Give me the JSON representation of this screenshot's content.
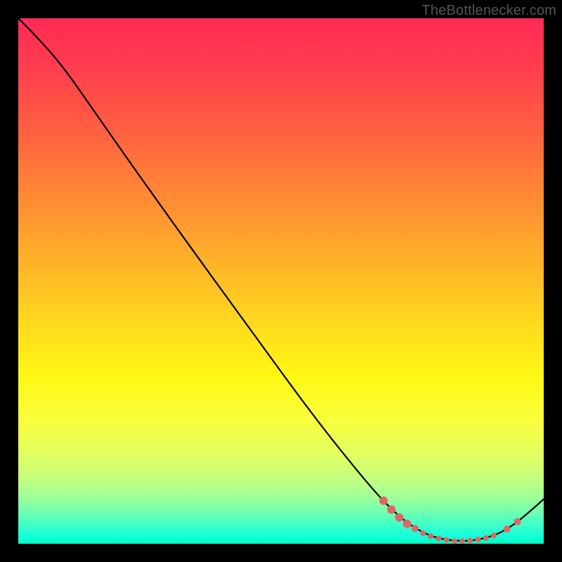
{
  "attribution": "TheBottlenecker.com",
  "chart_data": {
    "type": "line",
    "title": "",
    "xlabel": "",
    "ylabel": "",
    "xlim": [
      0,
      100
    ],
    "ylim": [
      0,
      100
    ],
    "curve": {
      "name": "bottleneck-curve",
      "color": "#000000",
      "points": [
        {
          "x": 0,
          "y": 100
        },
        {
          "x": 3,
          "y": 97
        },
        {
          "x": 8,
          "y": 91.5
        },
        {
          "x": 14,
          "y": 83
        },
        {
          "x": 22,
          "y": 71.5
        },
        {
          "x": 32,
          "y": 57.5
        },
        {
          "x": 44,
          "y": 41
        },
        {
          "x": 56,
          "y": 24.5
        },
        {
          "x": 66,
          "y": 12
        },
        {
          "x": 71,
          "y": 6.5
        },
        {
          "x": 75,
          "y": 3.2
        },
        {
          "x": 79,
          "y": 1.2
        },
        {
          "x": 83,
          "y": 0.5
        },
        {
          "x": 87,
          "y": 0.6
        },
        {
          "x": 91,
          "y": 1.7
        },
        {
          "x": 94,
          "y": 3.4
        },
        {
          "x": 97,
          "y": 5.8
        },
        {
          "x": 100,
          "y": 8.5
        }
      ]
    },
    "markers": {
      "name": "highlighted-region",
      "color": "#e06666",
      "radius_style": "varied",
      "points": [
        {
          "x": 69.5,
          "y": 8.2,
          "r": 6
        },
        {
          "x": 71.0,
          "y": 6.5,
          "r": 6
        },
        {
          "x": 72.5,
          "y": 5.0,
          "r": 6
        },
        {
          "x": 74.0,
          "y": 3.8,
          "r": 6
        },
        {
          "x": 75.5,
          "y": 2.9,
          "r": 5
        },
        {
          "x": 77.0,
          "y": 2.0,
          "r": 4
        },
        {
          "x": 78.5,
          "y": 1.4,
          "r": 4
        },
        {
          "x": 80.0,
          "y": 1.0,
          "r": 4
        },
        {
          "x": 81.5,
          "y": 0.7,
          "r": 4
        },
        {
          "x": 83.0,
          "y": 0.5,
          "r": 4
        },
        {
          "x": 84.5,
          "y": 0.5,
          "r": 4
        },
        {
          "x": 86.0,
          "y": 0.6,
          "r": 4
        },
        {
          "x": 87.5,
          "y": 0.8,
          "r": 4
        },
        {
          "x": 89.0,
          "y": 1.1,
          "r": 4
        },
        {
          "x": 90.5,
          "y": 1.6,
          "r": 4
        },
        {
          "x": 93.0,
          "y": 2.8,
          "r": 5
        },
        {
          "x": 95.0,
          "y": 4.2,
          "r": 5
        }
      ]
    },
    "gradient_stops_comment": "background vertical gradient from red (top, high bottleneck) to green (bottom, low bottleneck)"
  }
}
